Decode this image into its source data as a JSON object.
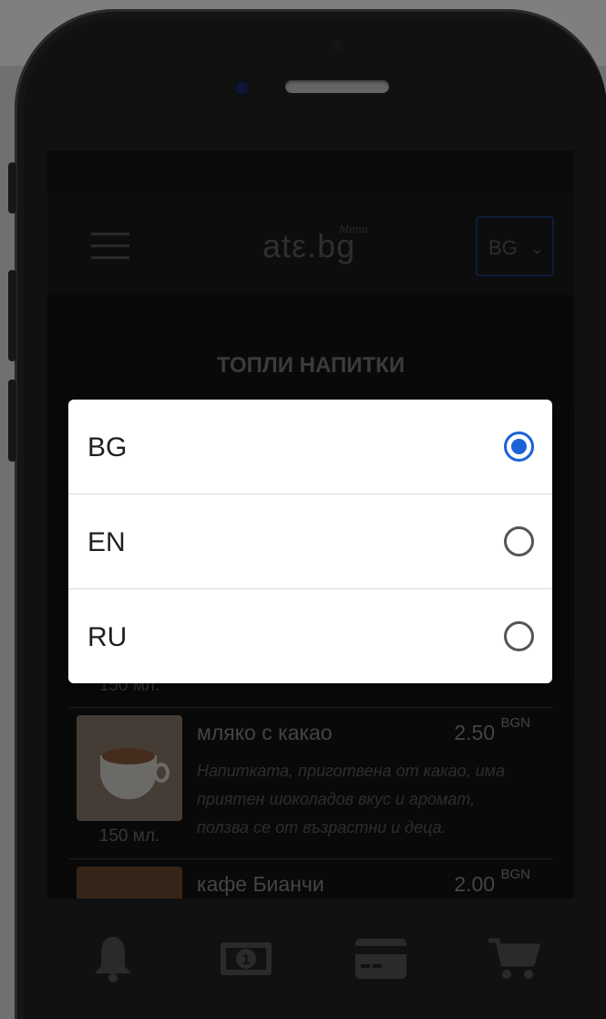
{
  "app": {
    "logo_text": "atε.bg",
    "logo_subtext": "Menu"
  },
  "header": {
    "language_select_value": "BG",
    "language_select_chevron": "⌄"
  },
  "section": {
    "title": "ТОПЛИ НАПИТКИ"
  },
  "menu_items": [
    {
      "qty": "150 мл."
    },
    {
      "name": "мляко с какао",
      "price": "2.50",
      "currency": "BGN",
      "description": "Напитката, приготвена от какао, има приятен шоколадов вкус и аромат, ползва се от възрастни и деца.",
      "qty": "150 мл."
    },
    {
      "name": "кафе Бианчи",
      "price": "2.00",
      "currency": "BGN"
    }
  ],
  "bottom_nav": [
    {
      "icon": "bell-icon"
    },
    {
      "icon": "cash-icon"
    },
    {
      "icon": "credit-card-icon"
    },
    {
      "icon": "cart-icon"
    }
  ],
  "language_dialog": {
    "options": [
      {
        "label": "BG",
        "selected": true
      },
      {
        "label": "EN",
        "selected": false
      },
      {
        "label": "RU",
        "selected": false
      }
    ]
  },
  "colors": {
    "accent": "#1a62d6",
    "screen_bg": "#121212",
    "phone_body": "#3c3c3c"
  }
}
